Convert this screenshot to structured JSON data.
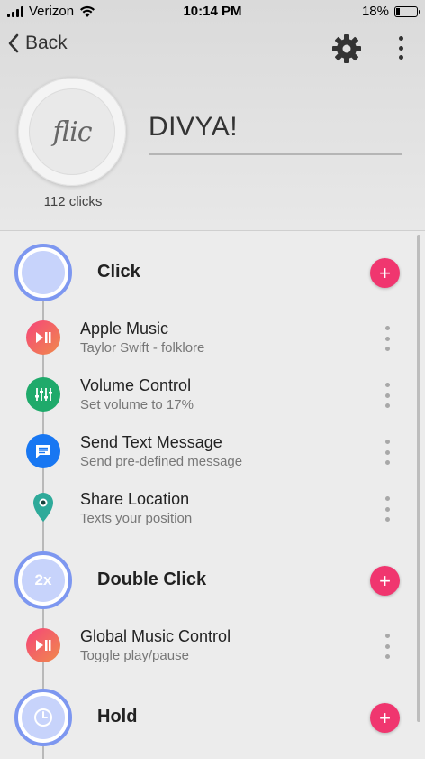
{
  "status_bar": {
    "carrier": "Verizon",
    "time": "10:14 PM",
    "battery": "18%",
    "battery_level": 0.18
  },
  "nav": {
    "back_label": "Back",
    "settings_icon": "gear-icon",
    "more_icon": "more-vertical-icon"
  },
  "device": {
    "logo": "flic",
    "name": "DIVYA!",
    "clicks": "112 clicks"
  },
  "colors": {
    "accent_pink": "#f0366f",
    "trigger_ring": "#7d97f0",
    "trigger_fill": "#c7d3fb",
    "music_gradient": [
      "#f5457a",
      "#f08a4b"
    ],
    "volume_green": "#1faa6b",
    "message_blue": "#1877f2",
    "location_teal": "#2eaa9a"
  },
  "triggers": [
    {
      "label": "Click",
      "icon": "",
      "add_label": "+",
      "actions": [
        {
          "title": "Apple Music",
          "subtitle": "Taylor Swift - folklore",
          "icon": "play-pause-icon"
        },
        {
          "title": "Volume Control",
          "subtitle": "Set volume to 17%",
          "icon": "equalizer-icon"
        },
        {
          "title": "Send Text Message",
          "subtitle": "Send pre-defined message",
          "icon": "message-icon"
        },
        {
          "title": "Share Location",
          "subtitle": "Texts your position",
          "icon": "location-pin-icon"
        }
      ]
    },
    {
      "label": "Double Click",
      "icon": "2x",
      "add_label": "+",
      "actions": [
        {
          "title": "Global Music Control",
          "subtitle": "Toggle play/pause",
          "icon": "play-pause-icon"
        }
      ]
    },
    {
      "label": "Hold",
      "icon": "clock-icon",
      "add_label": "+",
      "actions": []
    }
  ]
}
